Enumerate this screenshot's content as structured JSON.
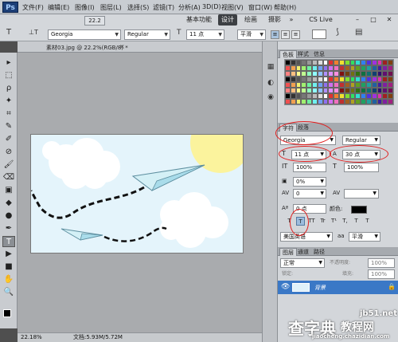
{
  "app": {
    "logo": "Ps"
  },
  "menu": {
    "items": [
      "文件(F)",
      "编辑(E)",
      "图像(I)",
      "图层(L)",
      "选择(S)",
      "滤镜(T)",
      "分析(A)",
      "3D(D)",
      "视图(V)",
      "窗口(W)",
      "帮助(H)"
    ],
    "zoom_label": "22.2",
    "workspace_buttons": [
      "基本功能",
      "设计",
      "绘画",
      "摄影"
    ],
    "active_workspace": "设计",
    "more_label": "»",
    "cs_live": "CS Live"
  },
  "options": {
    "font_family": "Georgia",
    "font_style": "Regular",
    "font_size": "11 点",
    "antialias": "平滑",
    "tool_glyph": "T",
    "orientation_glyph": "⊥T"
  },
  "document": {
    "tab_label": "素材03.jpg @ 22.2%(RGB/8) *",
    "close_glyph": "×"
  },
  "status": {
    "zoom": "22.18%",
    "doc_info": "文档:5.93M/5.72M"
  },
  "tools": [
    "▸",
    "⬚",
    "ρ",
    "✦",
    "⌗",
    "✎",
    "✐",
    "⊘",
    "🖌",
    "⌫",
    "▣",
    "◆",
    "●",
    "✒",
    "T",
    "▶",
    "■",
    "✋",
    "🔍"
  ],
  "active_tool_index": 14,
  "swatches_panel": {
    "tabs": [
      "色板",
      "样式",
      "信息"
    ],
    "active_tab": 0
  },
  "character_panel": {
    "tabs": [
      "字符",
      "段落"
    ],
    "active_tab": 0,
    "font_family": "Georgia",
    "font_style": "Regular",
    "font_size": "11 点",
    "leading": "30 点",
    "vertical_scale": "100%",
    "horizontal_scale": "100%",
    "tracking_ratio": "0%",
    "kerning": "0",
    "tracking": "",
    "baseline_shift": "0 点",
    "color_label": "颜色:",
    "style_buttons": [
      "T",
      "T",
      "TT",
      "Tr",
      "T¹",
      "T,",
      "T",
      "T"
    ],
    "active_style_index": 1,
    "language": "美国英语",
    "antialias_icon": "aa",
    "antialias": "平滑"
  },
  "layers_panel": {
    "tabs": [
      "图层",
      "通道",
      "路径"
    ],
    "active_tab": 0,
    "blend_mode": "正常",
    "opacity_label": "不透明度:",
    "opacity": "100%",
    "lock_label": "锁定:",
    "fill_label": "填充:",
    "fill": "100%",
    "layer_name": "背景"
  },
  "watermarks": {
    "left": "查字典",
    "right_top": "教程网",
    "site": "jb51.net",
    "url": "jiaocheng.chazidian.com"
  },
  "colors": {
    "accent": "#3a78c6",
    "highlight_red": "#e01d1d",
    "sky": "#e4f4fb",
    "sun": "#fbf39d"
  }
}
